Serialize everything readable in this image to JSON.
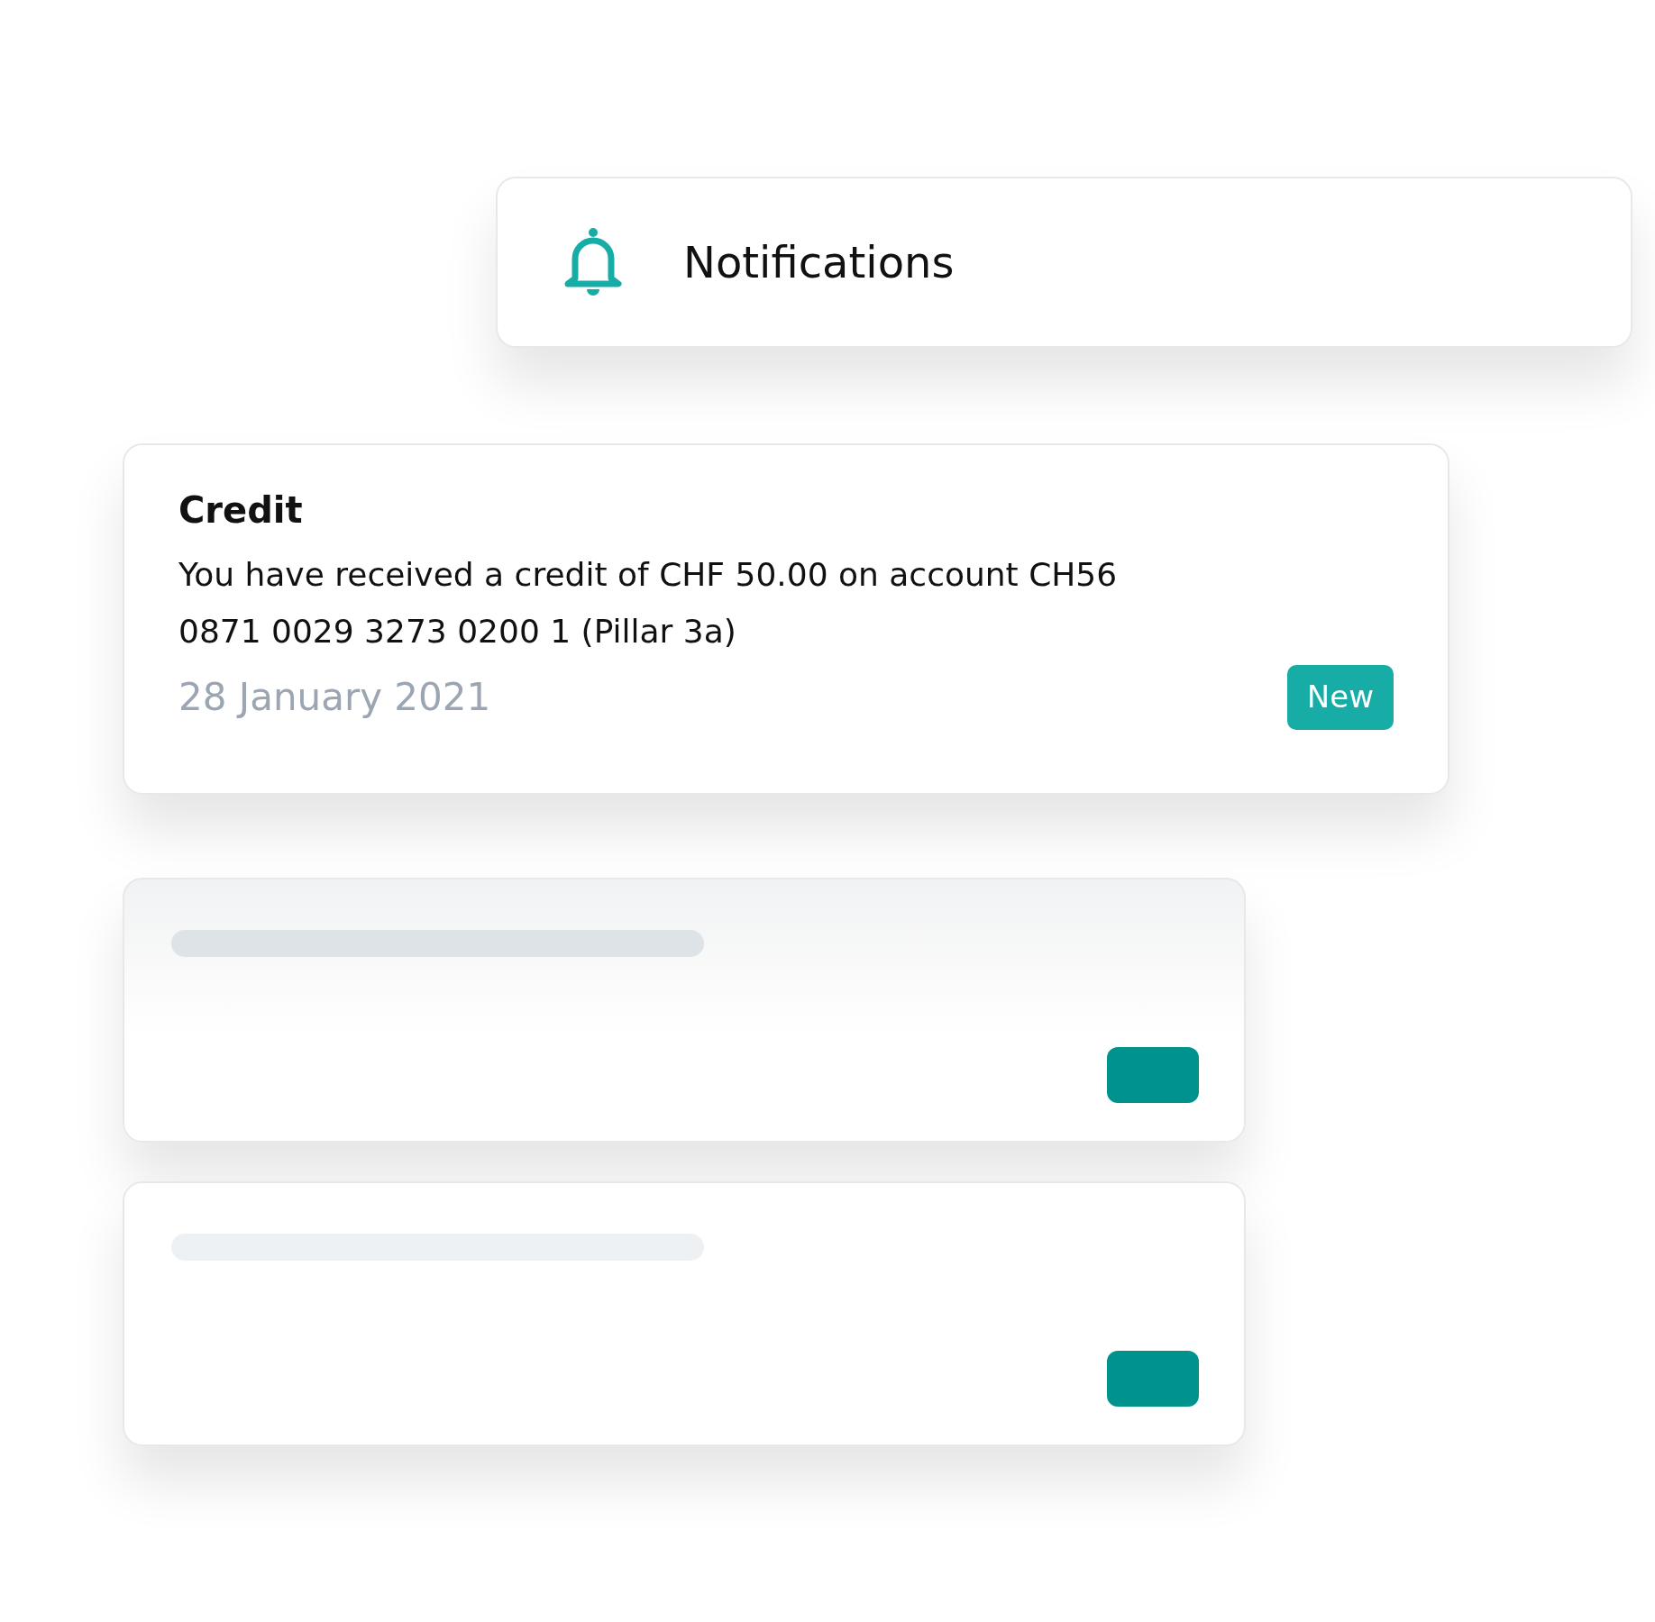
{
  "header": {
    "title": "Notifications"
  },
  "notifications": [
    {
      "title": "Credit",
      "message": "You have received a credit of CHF 50.00 on account CH56 0871 0029 3273 0200 1 (Pillar 3a)",
      "date": "28 January 2021",
      "badge": "New"
    }
  ],
  "placeholder_cards": [
    {
      "kind": "skeleton"
    },
    {
      "kind": "skeleton"
    }
  ]
}
